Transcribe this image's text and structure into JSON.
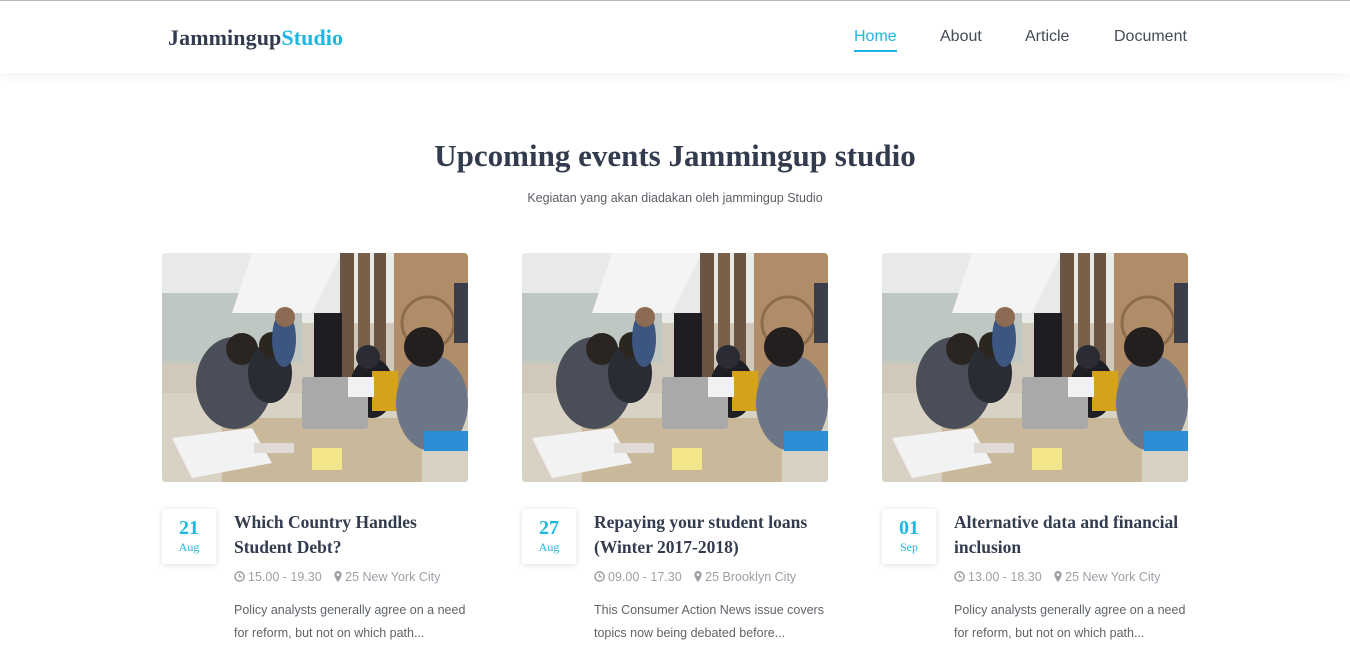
{
  "header": {
    "brand_main": "Jammingup",
    "brand_accent": "Studio",
    "nav": [
      {
        "label": "Home",
        "active": true
      },
      {
        "label": "About",
        "active": false
      },
      {
        "label": "Article",
        "active": false
      },
      {
        "label": "Document",
        "active": false
      }
    ]
  },
  "hero": {
    "title": "Upcoming events Jammingup studio",
    "subtitle": "Kegiatan yang akan diadakan oleh jammingup Studio"
  },
  "events": [
    {
      "day": "21",
      "month": "Aug",
      "title": "Which Country Handles Student Debt?",
      "time": "15.00 - 19.30",
      "location": "25 New York City",
      "excerpt": "Policy analysts generally agree on a need for reform, but not on which path..."
    },
    {
      "day": "27",
      "month": "Aug",
      "title": "Repaying your student loans (Winter 2017-2018)",
      "time": "09.00 - 17.30",
      "location": "25 Brooklyn City",
      "excerpt": "This Consumer Action News issue covers topics now being debated before..."
    },
    {
      "day": "01",
      "month": "Sep",
      "title": "Alternative data and financial inclusion",
      "time": "13.00 - 18.30",
      "location": "25 New York City",
      "excerpt": "Policy analysts generally agree on a need for reform, but not on which path..."
    }
  ],
  "icons": {
    "time": "clock-icon",
    "location": "map-marker-icon"
  },
  "colors": {
    "accent": "#1eb7e1",
    "heading": "#333c4e",
    "muted": "#9ba0a7"
  }
}
